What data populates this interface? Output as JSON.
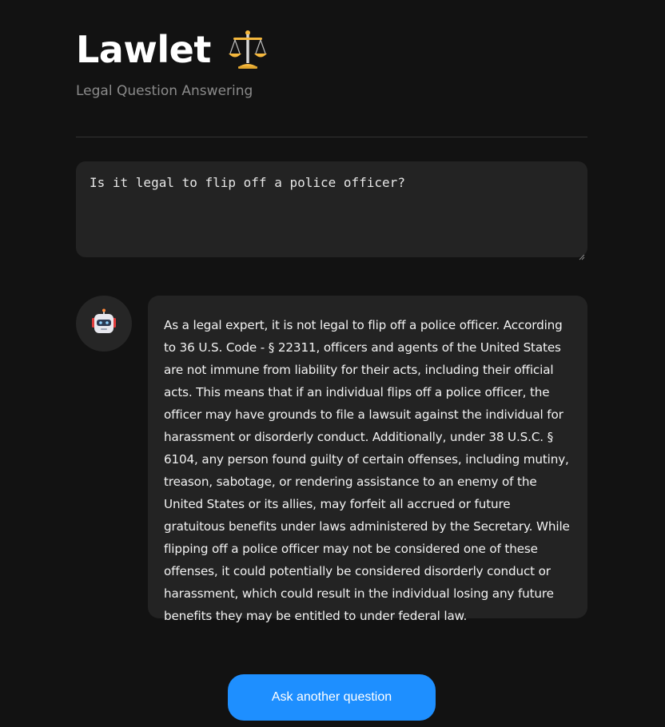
{
  "header": {
    "title": "Lawlet",
    "icon": "scales-icon",
    "subtitle": "Legal Question Answering"
  },
  "question": {
    "value": "Is it legal to flip off a police officer?"
  },
  "answer": {
    "avatar_icon": "robot-icon",
    "text": "As a legal expert, it is not legal to flip off a police officer. According to 36 U.S. Code - § 22311, officers and agents of the United States are not immune from liability for their acts, including their official acts. This means that if an individual flips off a police officer, the officer may have grounds to file a lawsuit against the individual for harassment or disorderly conduct. Additionally, under 38 U.S.C. § 6104, any person found guilty of certain offenses, including mutiny, treason, sabotage, or rendering assistance to an enemy of the United States or its allies, may forfeit all accrued or future gratuitous benefits under laws administered by the Secretary. While flipping off a police officer may not be considered one of these offenses, it could potentially be considered disorderly conduct or harassment, which could result in the individual losing any future benefits they may be entitled to under federal law."
  },
  "actions": {
    "ask_another_label": "Ask another question"
  },
  "colors": {
    "background": "#121212",
    "panel": "#232323",
    "accent": "#1e8fff",
    "subtitle": "#8a8a8a"
  }
}
